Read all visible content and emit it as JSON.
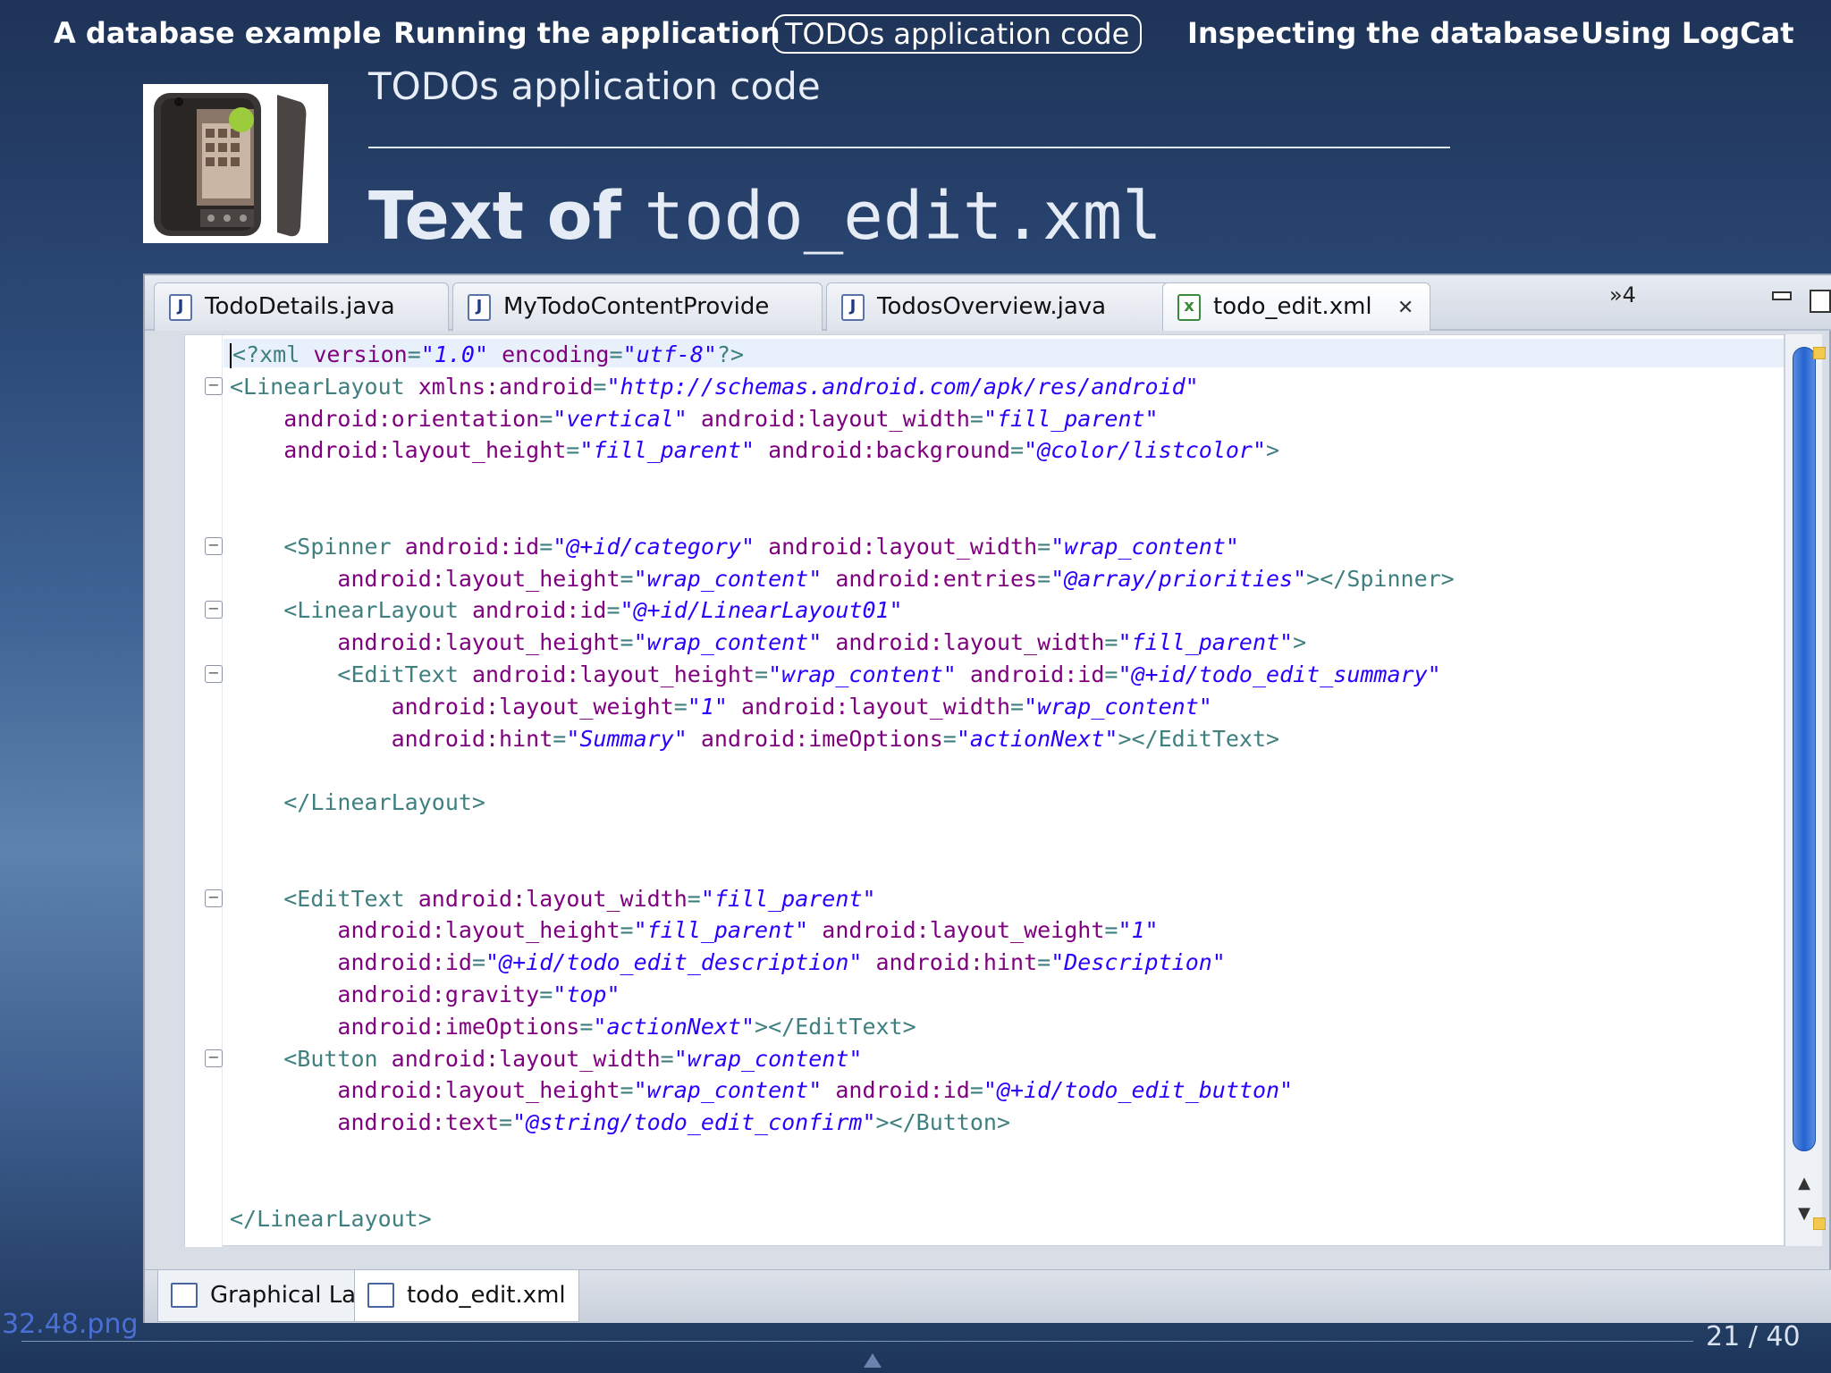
{
  "nav": {
    "items": [
      {
        "label": "A database example",
        "active": false
      },
      {
        "label": "Running the application",
        "active": false
      },
      {
        "label": "TODOs application code",
        "active": true
      },
      {
        "label": "Inspecting the database",
        "active": false
      },
      {
        "label": "Using LogCat",
        "active": false
      }
    ]
  },
  "frame": {
    "section_title": "TODOs application code",
    "title_plain": "Text of",
    "title_mono": "todo_edit.xml"
  },
  "editor": {
    "tabs": [
      {
        "label": "TodoDetails.java",
        "icon": "java-file-icon"
      },
      {
        "label": "MyTodoContentProvide",
        "icon": "java-file-icon"
      },
      {
        "label": "TodosOverview.java",
        "icon": "java-file-icon"
      },
      {
        "label": "todo_edit.xml",
        "icon": "xml-file-icon",
        "active": true
      }
    ],
    "overflow_label": "»4",
    "bottom_tabs": [
      {
        "label": "Graphical Layout",
        "icon": "layout-icon"
      },
      {
        "label": "todo_edit.xml",
        "icon": "xml-source-icon"
      }
    ],
    "code_lines": [
      "<?xml version=\"1.0\" encoding=\"utf-8\"?>",
      "<LinearLayout xmlns:android=\"http://schemas.android.com/apk/res/android\"",
      "    android:orientation=\"vertical\" android:layout_width=\"fill_parent\"",
      "    android:layout_height=\"fill_parent\" android:background=\"@color/listcolor\">",
      "",
      "",
      "    <Spinner android:id=\"@+id/category\" android:layout_width=\"wrap_content\"",
      "        android:layout_height=\"wrap_content\" android:entries=\"@array/priorities\"></Spinner>",
      "    <LinearLayout android:id=\"@+id/LinearLayout01\"",
      "        android:layout_height=\"wrap_content\" android:layout_width=\"fill_parent\">",
      "        <EditText android:layout_height=\"wrap_content\" android:id=\"@+id/todo_edit_summary\"",
      "            android:layout_weight=\"1\" android:layout_width=\"wrap_content\"",
      "            android:hint=\"Summary\" android:imeOptions=\"actionNext\"></EditText>",
      "",
      "    </LinearLayout>",
      "",
      "",
      "    <EditText android:layout_width=\"fill_parent\"",
      "        android:layout_height=\"fill_parent\" android:layout_weight=\"1\"",
      "        android:id=\"@+id/todo_edit_description\" android:hint=\"Description\"",
      "        android:gravity=\"top\"",
      "        android:imeOptions=\"actionNext\"></EditText>",
      "    <Button android:layout_width=\"wrap_content\"",
      "        android:layout_height=\"wrap_content\" android:id=\"@+id/todo_edit_button\"",
      "        android:text=\"@string/todo_edit_confirm\"></Button>",
      "",
      "",
      "</LinearLayout>"
    ],
    "fold_lines": [
      1,
      6,
      8,
      10,
      17,
      22
    ]
  },
  "footer": {
    "file_label": "32.48.png",
    "page": "21 / 40"
  },
  "colors": {
    "xml_tag": "#3f7f7f",
    "xml_attr": "#7f007f",
    "xml_value": "#2a00ff",
    "scroll_thumb": "#2563cf"
  }
}
